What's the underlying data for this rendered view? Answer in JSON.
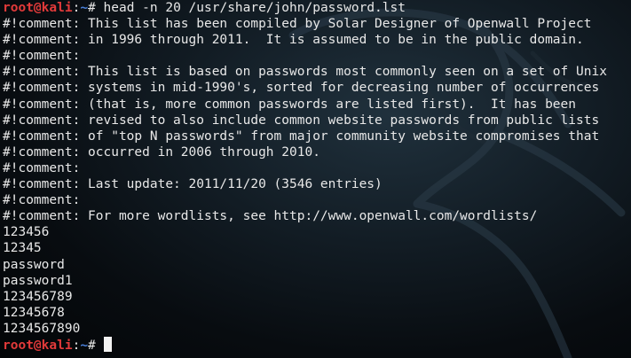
{
  "prompt": {
    "user_host": "root@kali",
    "separator": ":",
    "path": "~",
    "symbol": "# "
  },
  "command": "head -n 20 /usr/share/john/password.lst",
  "output_lines": [
    "#!comment: This list has been compiled by Solar Designer of Openwall Project",
    "#!comment: in 1996 through 2011.  It is assumed to be in the public domain.",
    "#!comment:",
    "#!comment: This list is based on passwords most commonly seen on a set of Unix",
    "#!comment: systems in mid-1990's, sorted for decreasing number of occurrences",
    "#!comment: (that is, more common passwords are listed first).  It has been",
    "#!comment: revised to also include common website passwords from public lists",
    "#!comment: of \"top N passwords\" from major community website compromises that",
    "#!comment: occurred in 2006 through 2010.",
    "#!comment:",
    "#!comment: Last update: 2011/11/20 (3546 entries)",
    "#!comment:",
    "#!comment: For more wordlists, see http://www.openwall.com/wordlists/",
    "123456",
    "12345",
    "password",
    "password1",
    "123456789",
    "12345678",
    "1234567890"
  ],
  "colors": {
    "prompt_user": "#e23a3a",
    "prompt_path": "#4a7fd8",
    "text": "#e8e8e8",
    "background": "#0b1218"
  },
  "icons": {
    "background": "kali-dragon-wallpaper"
  }
}
